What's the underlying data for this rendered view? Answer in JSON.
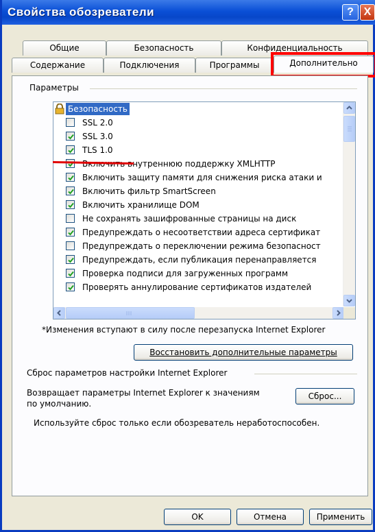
{
  "window": {
    "title": "Свойства обозреватели",
    "help_label": "?",
    "close_label": "X"
  },
  "tabs": {
    "row1": [
      "Общие",
      "Безопасность",
      "Конфиденциальность"
    ],
    "row2": [
      "Содержание",
      "Подключения",
      "Программы",
      "Дополнительно"
    ],
    "active": "Дополнительно"
  },
  "params": {
    "group_label": "Параметры",
    "header": "Безопасность",
    "items": [
      {
        "label": "SSL 2.0",
        "checked": false
      },
      {
        "label": "SSL 3.0",
        "checked": true
      },
      {
        "label": "TLS 1.0",
        "checked": true
      },
      {
        "label": "Включить внутреннюю поддержку XMLHTTP",
        "checked": true
      },
      {
        "label": "Включить защиту памяти для снижения риска атаки и",
        "checked": true
      },
      {
        "label": "Включить фильтр SmartScreen",
        "checked": true
      },
      {
        "label": "Включить хранилище DOM",
        "checked": true
      },
      {
        "label": "Не сохранять зашифрованные страницы на диск",
        "checked": false
      },
      {
        "label": "Предупреждать о несоответствии адреса сертификат",
        "checked": true
      },
      {
        "label": "Предупреждать о переключении режима безопасност",
        "checked": false
      },
      {
        "label": "Предупреждать, если публикация перенаправляется",
        "checked": true
      },
      {
        "label": "Проверка подписи для загруженных программ",
        "checked": true
      },
      {
        "label": "Проверять аннулирование сертификатов издателей",
        "checked": true
      }
    ],
    "note": "*Изменения вступают в силу после перезапуска Internet Explorer",
    "restore_button": "Восстановить дополнительные параметры"
  },
  "reset": {
    "group_label": "Сброс параметров настройки Internet Explorer",
    "description_line1": "Возвращает параметры Internet Explorer к значениям",
    "description_line2": "по умолчанию.",
    "button": "Сброс...",
    "warning": "Используйте сброс только если обозреватель неработоспособен."
  },
  "footer": {
    "ok": "OK",
    "cancel": "Отмена",
    "apply": "Применить"
  },
  "colors": {
    "highlight": "#ff0000",
    "selection": "#316ac5",
    "title_bar": "#0a4fd6"
  }
}
